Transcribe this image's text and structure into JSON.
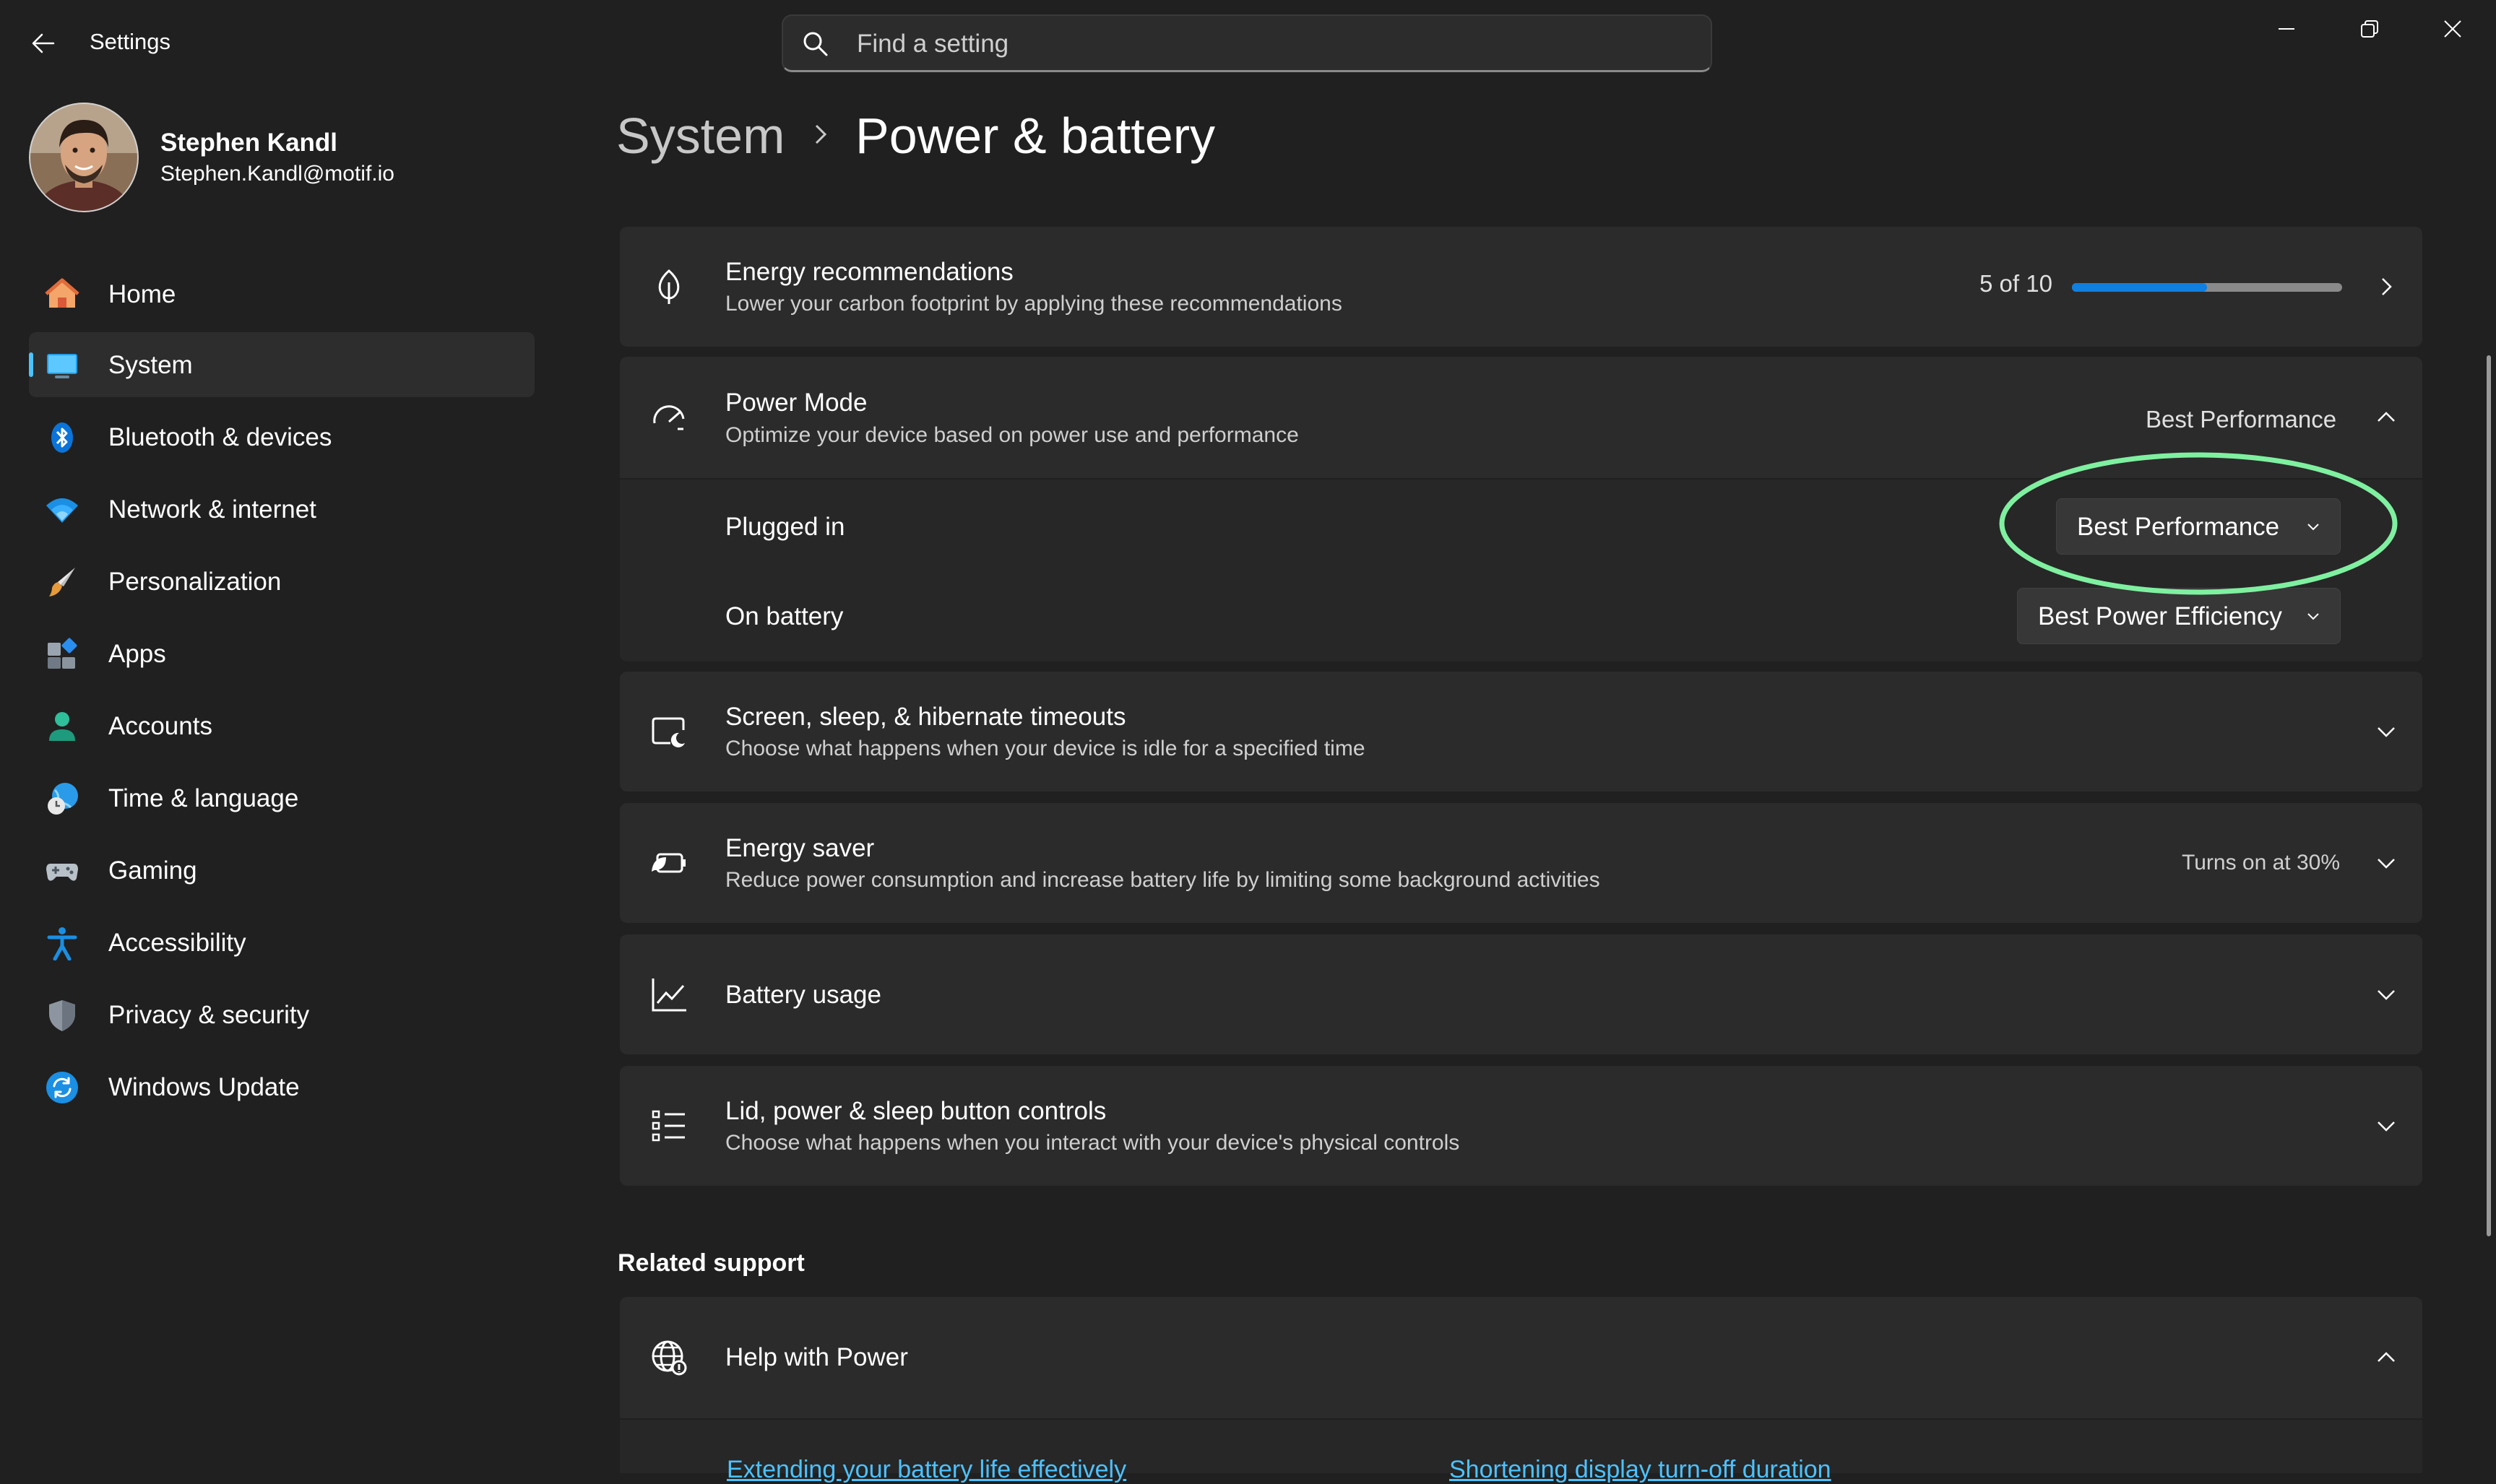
{
  "app": {
    "title": "Settings"
  },
  "search": {
    "placeholder": "Find a setting"
  },
  "user": {
    "name": "Stephen Kandl",
    "email": "Stephen.Kandl@motif.io"
  },
  "nav": [
    {
      "label": "Home",
      "icon": "home-icon"
    },
    {
      "label": "System",
      "icon": "system-icon",
      "selected": true
    },
    {
      "label": "Bluetooth & devices",
      "icon": "bluetooth-icon"
    },
    {
      "label": "Network & internet",
      "icon": "wifi-icon"
    },
    {
      "label": "Personalization",
      "icon": "brush-icon"
    },
    {
      "label": "Apps",
      "icon": "apps-icon"
    },
    {
      "label": "Accounts",
      "icon": "person-icon"
    },
    {
      "label": "Time & language",
      "icon": "globe-clock-icon"
    },
    {
      "label": "Gaming",
      "icon": "gamepad-icon"
    },
    {
      "label": "Accessibility",
      "icon": "accessibility-icon"
    },
    {
      "label": "Privacy & security",
      "icon": "shield-icon"
    },
    {
      "label": "Windows Update",
      "icon": "update-icon"
    }
  ],
  "breadcrumb": {
    "parent": "System",
    "current": "Power & battery"
  },
  "energy_rec": {
    "title": "Energy recommendations",
    "desc": "Lower your carbon footprint by applying these recommendations",
    "progress_text": "5 of 10",
    "progress_fraction": 0.5
  },
  "power_mode": {
    "title": "Power Mode",
    "desc": "Optimize your device based on power use and performance",
    "value": "Best Performance",
    "plugged_in_label": "Plugged in",
    "plugged_in_value": "Best Performance",
    "on_battery_label": "On battery",
    "on_battery_value": "Best Power Efficiency"
  },
  "screen_sleep": {
    "title": "Screen, sleep, & hibernate timeouts",
    "desc": "Choose what happens when your device is idle for a specified time"
  },
  "energy_saver": {
    "title": "Energy saver",
    "desc": "Reduce power consumption and increase battery life by limiting some background activities",
    "value": "Turns on at 30%"
  },
  "battery_usage": {
    "title": "Battery usage"
  },
  "lid_power": {
    "title": "Lid, power & sleep button controls",
    "desc": "Choose what happens when you interact with your device's physical controls"
  },
  "related": {
    "heading": "Related support",
    "help_title": "Help with Power",
    "links": [
      "Extending your battery life effectively",
      "Shortening display turn-off duration"
    ]
  },
  "colors": {
    "accent": "#4cc2ff",
    "highlight": "#7ff0a0",
    "progress": "#0f7fe0"
  }
}
